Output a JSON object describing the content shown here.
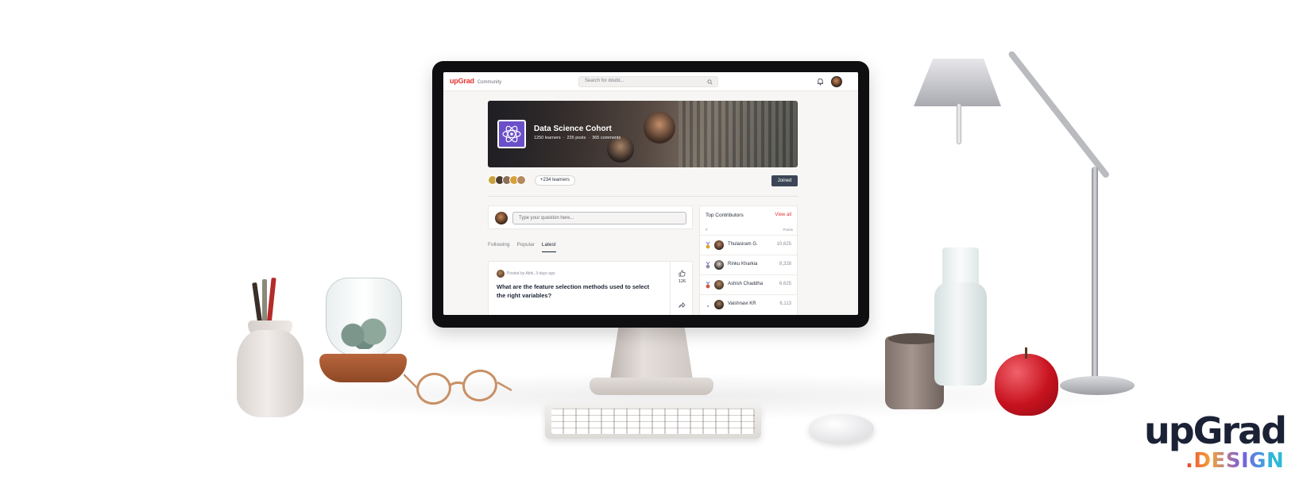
{
  "topbar": {
    "logo": "upGrad",
    "logo_sub": "Community",
    "search_placeholder": "Search for doubt..."
  },
  "banner": {
    "title": "Data Science Cohort",
    "learners": "1250 learners",
    "posts": "235 posts",
    "comments": "365 comments",
    "separator": "·"
  },
  "members": {
    "count_label": "+234 learners",
    "joined_label": "Joined"
  },
  "ask": {
    "placeholder": "Type your question here..."
  },
  "tabs": [
    {
      "label": "Following",
      "active": false
    },
    {
      "label": "Popular",
      "active": false
    },
    {
      "label": "Latest",
      "active": true
    }
  ],
  "post": {
    "meta": "Posted by Abhi, 3 days ago",
    "title": "What are the feature selection methods used to select the right variables?",
    "likes": "126"
  },
  "contributors": {
    "title": "Top Contributors",
    "view_all": "View all",
    "col_rank": "#",
    "col_points": "Points",
    "rows": [
      {
        "name": "Thulasiram G.",
        "points": "10,625",
        "medal": "gold"
      },
      {
        "name": "Rinku Kharkia",
        "points": "8,328",
        "medal": "silver"
      },
      {
        "name": "Ashish Chaddha",
        "points": "6,625",
        "medal": "bronze"
      },
      {
        "name": "Vaishnavi KR",
        "points": "6,113",
        "medal": "none"
      }
    ]
  },
  "brand": {
    "main": "upGrad",
    "sub": ".DESIGN"
  },
  "colors": {
    "accent": "#e5312f",
    "cohort_icon": "#6a4fc9",
    "joined_button": "#3d4656",
    "medal_gold": "#d8a62b",
    "medal_silver": "#8f8fb3",
    "medal_bronze": "#d2583f"
  },
  "icons": [
    "search-icon",
    "bell-icon",
    "atom-icon",
    "like-icon",
    "share-icon",
    "medal-icon"
  ]
}
